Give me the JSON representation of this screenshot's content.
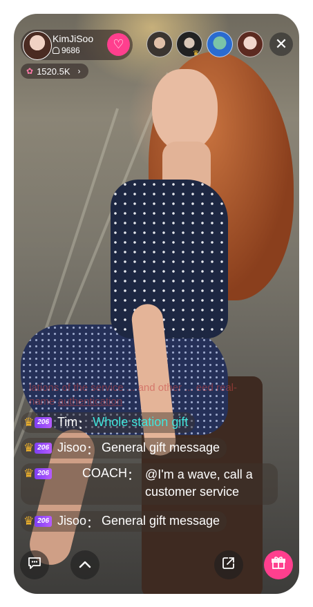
{
  "host": {
    "name": "KimJiSoo",
    "fans": "9686",
    "score": "1520.5K"
  },
  "icons": {
    "follow": "heart-icon",
    "close": "close-icon",
    "score": "flower-icon",
    "comment": "chat-bubble-icon",
    "more": "chevron-up-icon",
    "share": "share-icon",
    "gift": "gift-icon"
  },
  "notice": {
    "text": "lations of the service ... and other ... eed real-name",
    "link": "authentication"
  },
  "chat": [
    {
      "level": "206",
      "name": "Tim",
      "sep": "：",
      "message": "Whole station gift"
    },
    {
      "level": "206",
      "name": "Jisoo",
      "sep": "：",
      "message": "General gift message"
    },
    {
      "level": "206",
      "name": "COACH",
      "sep": "：",
      "message": "@I'm a wave, call a customer service"
    },
    {
      "level": "206",
      "name": "Jisoo",
      "sep": "：",
      "message": "General gift message"
    }
  ],
  "colors": {
    "accent": "#ff3f8e",
    "highlight": "#41e6dd",
    "level_badge": "#7e3ff2"
  }
}
